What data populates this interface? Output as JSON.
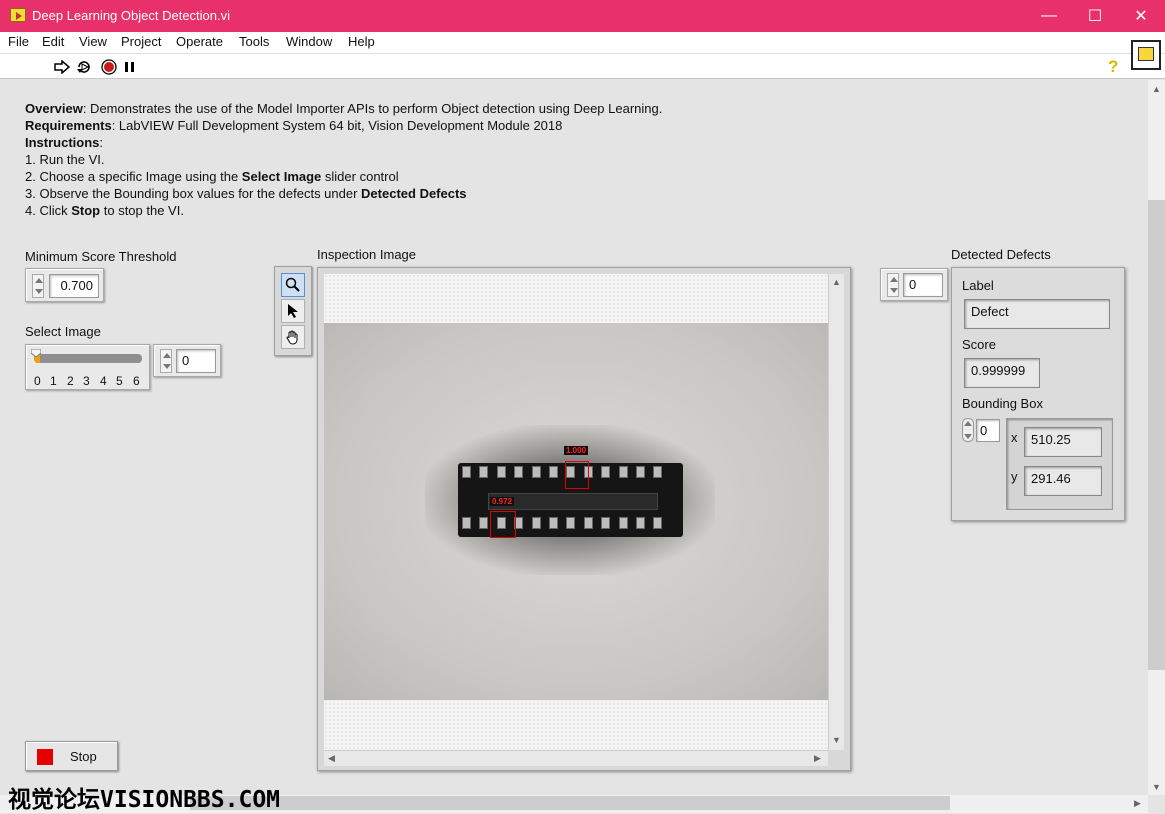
{
  "window": {
    "title": "Deep Learning Object Detection.vi",
    "minimize": "—",
    "maximize": "☐",
    "close": "✕"
  },
  "menu": [
    "File",
    "Edit",
    "View",
    "Project",
    "Operate",
    "Tools",
    "Window",
    "Help"
  ],
  "toolbar": {
    "run_icon": "run-arrow-icon",
    "run_continuous_icon": "run-continuously-icon",
    "abort_icon": "abort-icon",
    "pause_icon": "pause-icon",
    "help_glyph": "?"
  },
  "description": {
    "overview_label": "Overview",
    "overview_text": ": Demonstrates the use of the Model Importer APIs to perform Object detection using Deep Learning.",
    "requirements_label": "Requirements",
    "requirements_text": ": LabVIEW Full Development System 64 bit, Vision Development Module 2018",
    "instructions_label": "Instructions",
    "instructions_colon": ":",
    "step1": "1. Run the VI.",
    "step2_pre": "2. Choose a specific Image using the ",
    "step2_bold": "Select Image",
    "step2_post": " slider control",
    "step3_pre": "3. Observe the Bounding box values for the defects under ",
    "step3_bold": "Detected Defects",
    "step4_pre": "4. Click ",
    "step4_bold": "Stop",
    "step4_post": " to stop the VI."
  },
  "min_score": {
    "label": "Minimum Score Threshold",
    "value": "0.700"
  },
  "select_image": {
    "label": "Select Image",
    "ticks": [
      "0",
      "1",
      "2",
      "3",
      "4",
      "5",
      "6"
    ],
    "value": "0",
    "slider_position": 0,
    "slider_max": 6
  },
  "inspection_image": {
    "label": "Inspection Image",
    "detections": [
      {
        "score_text": "1.000"
      },
      {
        "score_text": "0.972"
      }
    ]
  },
  "detected_defects": {
    "label": "Detected Defects",
    "index": "0",
    "label_field_caption": "Label",
    "label_value": "Defect",
    "score_caption": "Score",
    "score_value": "0.999999",
    "bbox_caption": "Bounding Box",
    "bbox_index": "0",
    "x_caption": "x",
    "x_value": "510.25",
    "y_caption": "y",
    "y_value": "291.46"
  },
  "stop_button": {
    "label": "Stop"
  },
  "watermark": "视觉论坛VISIONBBS.COM",
  "colors": {
    "titlebar": "#e8306b",
    "stop_red": "#e40000",
    "slider_fill": "#f0a20a",
    "bbox_red": "#e00000"
  }
}
